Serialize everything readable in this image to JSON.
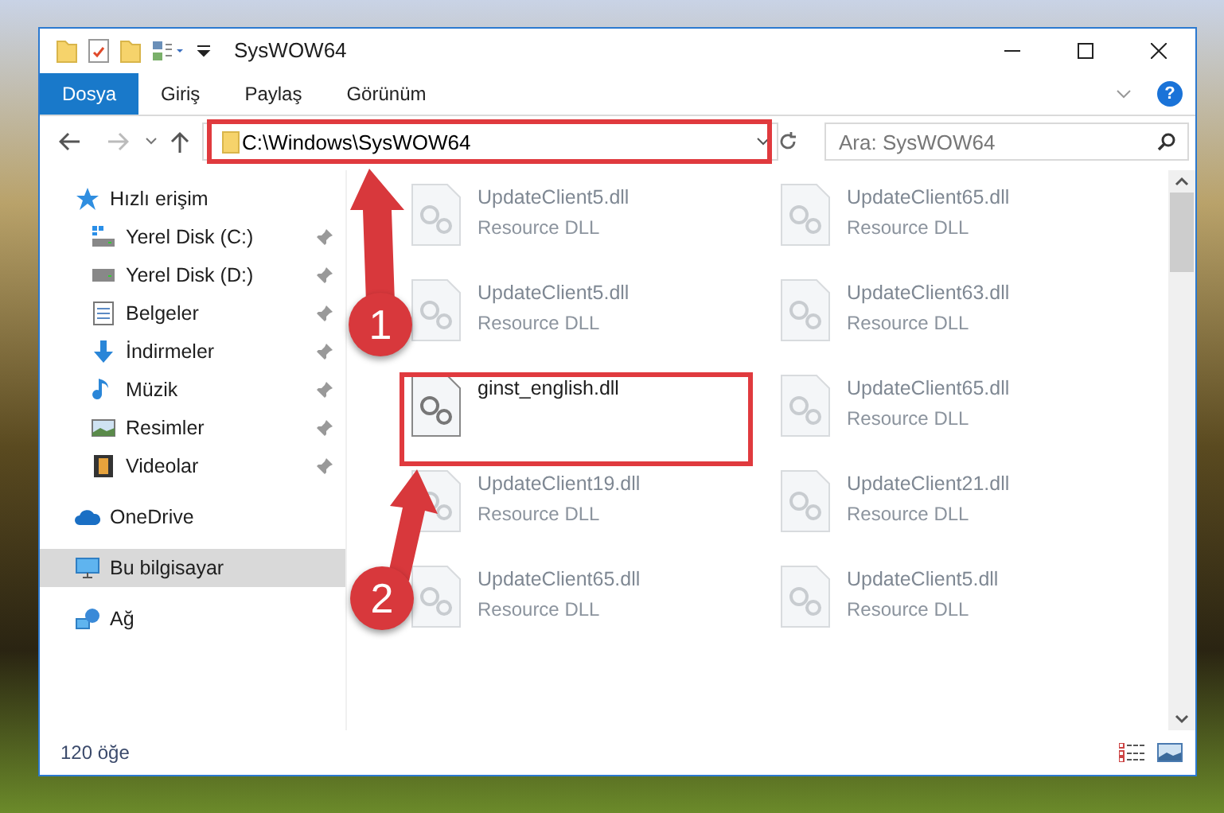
{
  "window": {
    "title": "SysWOW64"
  },
  "ribbon": {
    "tabs": [
      {
        "label": "Dosya",
        "selected": true
      },
      {
        "label": "Giriş",
        "selected": false
      },
      {
        "label": "Paylaş",
        "selected": false
      },
      {
        "label": "Görünüm",
        "selected": false
      }
    ],
    "help": "?"
  },
  "address": {
    "path": "C:\\Windows\\SysWOW64"
  },
  "search": {
    "placeholder": "Ara: SysWOW64"
  },
  "sidebar": {
    "items": [
      {
        "label": "Hızlı erişim",
        "selected": false,
        "children": [
          {
            "label": "Yerel Disk (C:)",
            "pinned": true
          },
          {
            "label": "Yerel Disk (D:)",
            "pinned": true
          },
          {
            "label": "Belgeler",
            "pinned": true
          },
          {
            "label": "İndirmeler",
            "pinned": true
          },
          {
            "label": "Müzik",
            "pinned": true
          },
          {
            "label": "Resimler",
            "pinned": true
          },
          {
            "label": "Videolar",
            "pinned": true
          }
        ]
      },
      {
        "label": "OneDrive",
        "selected": false
      },
      {
        "label": "Bu bilgisayar",
        "selected": true
      },
      {
        "label": "Ağ",
        "selected": false
      }
    ]
  },
  "files": [
    {
      "name": "UpdateClient5.dll",
      "type": "Resource DLL",
      "selected": false
    },
    {
      "name": "UpdateClient65.dll",
      "type": "Resource DLL",
      "selected": false
    },
    {
      "name": "UpdateClient5.dll",
      "type": "Resource DLL",
      "selected": false
    },
    {
      "name": "UpdateClient63.dll",
      "type": "Resource DLL",
      "selected": false
    },
    {
      "name": "ginst_english.dll",
      "selected": true
    },
    {
      "name": "UpdateClient65.dll",
      "type": "Resource DLL",
      "selected": false
    },
    {
      "name": "UpdateClient19.dll",
      "type": "Resource DLL",
      "selected": false
    },
    {
      "name": "UpdateClient21.dll",
      "type": "Resource DLL",
      "selected": false
    },
    {
      "name": "UpdateClient65.dll",
      "type": "Resource DLL",
      "selected": false
    },
    {
      "name": "UpdateClient5.dll",
      "type": "Resource DLL",
      "selected": false
    }
  ],
  "status_bar": {
    "count": "120 öğe"
  },
  "annotations": [
    {
      "number": "1"
    },
    {
      "number": "2"
    }
  ]
}
